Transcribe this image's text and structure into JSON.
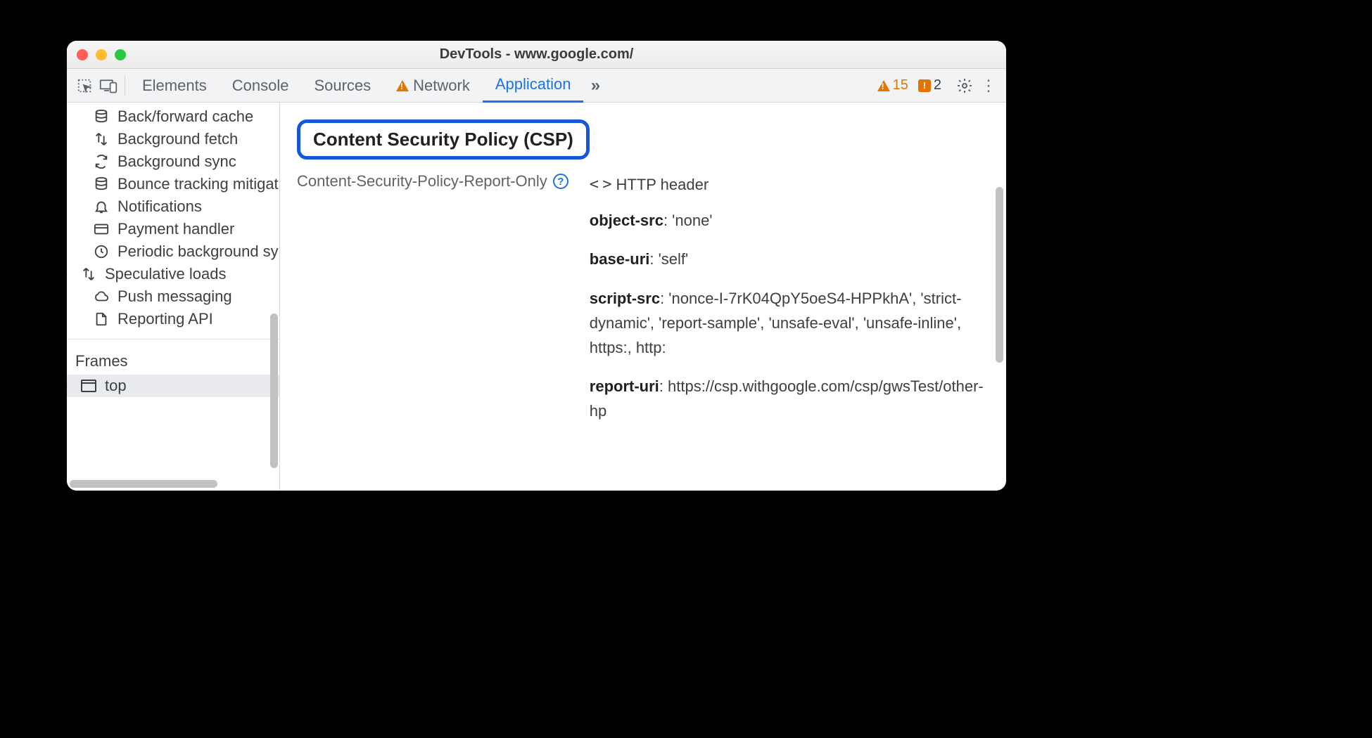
{
  "window": {
    "title": "DevTools - www.google.com/"
  },
  "tabs": [
    "Elements",
    "Console",
    "Sources",
    "Network",
    "Application"
  ],
  "activeTab": "Application",
  "badges": {
    "warnings": 15,
    "errors": 2
  },
  "sidebar": {
    "items": [
      {
        "icon": "database",
        "label": "Back/forward cache"
      },
      {
        "icon": "updown",
        "label": "Background fetch"
      },
      {
        "icon": "sync",
        "label": "Background sync"
      },
      {
        "icon": "database",
        "label": "Bounce tracking mitigations"
      },
      {
        "icon": "bell",
        "label": "Notifications"
      },
      {
        "icon": "card",
        "label": "Payment handler"
      },
      {
        "icon": "clock",
        "label": "Periodic background sync"
      },
      {
        "icon": "updown",
        "label": "Speculative loads",
        "arrow": true
      },
      {
        "icon": "cloud",
        "label": "Push messaging"
      },
      {
        "icon": "file",
        "label": "Reporting API"
      }
    ],
    "section": "Frames",
    "frames": {
      "label": "top"
    }
  },
  "main": {
    "heading": "Content Security Policy (CSP)",
    "policyName": "Content-Security-Policy-Report-Only",
    "sourceLabel": "HTTP header",
    "directives": [
      {
        "name": "object-src",
        "value": "'none'"
      },
      {
        "name": "base-uri",
        "value": "'self'"
      },
      {
        "name": "script-src",
        "value": "'nonce-I-7rK04QpY5oeS4-HPPkhA', 'strict-dynamic', 'report-sample', 'unsafe-eval', 'unsafe-inline', https:, http:"
      },
      {
        "name": "report-uri",
        "value": "https://csp.withgoogle.com/csp/gwsTest/other-hp"
      }
    ]
  }
}
